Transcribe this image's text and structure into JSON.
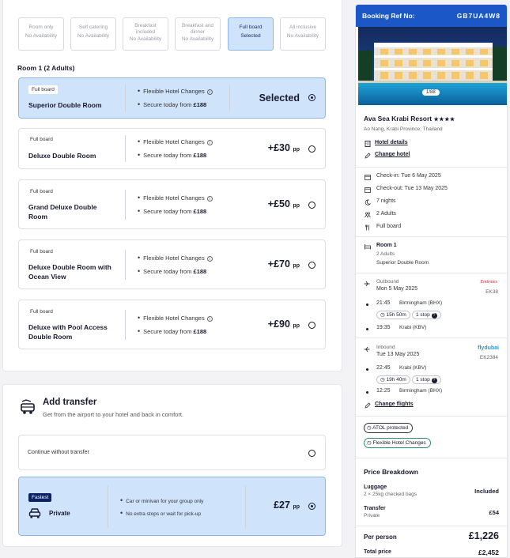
{
  "board_options": [
    {
      "label": "Room only",
      "status": "No Availability"
    },
    {
      "label": "Self catering",
      "status": "No Availability"
    },
    {
      "label": "Breakfast included",
      "status": "No Availability"
    },
    {
      "label": "Breakfast and dinner",
      "status": "No Availability"
    },
    {
      "label": "Full board",
      "status": "Selected"
    },
    {
      "label": "All inclusive",
      "status": "No Availability"
    }
  ],
  "room_heading": "Room 1 (2 Adults)",
  "rooms": [
    {
      "tag": "Full board",
      "name": "Superior Double Room",
      "feature1": "Flexible Hotel Changes",
      "feature2_prefix": "Secure today from",
      "feature2_price": "£188",
      "price": "Selected",
      "pp": ""
    },
    {
      "tag": "Full board",
      "name": "Deluxe Double Room",
      "feature1": "Flexible Hotel Changes",
      "feature2_prefix": "Secure today from",
      "feature2_price": "£188",
      "price": "+£30",
      "pp": "pp"
    },
    {
      "tag": "Full board",
      "name": "Grand Deluxe Double Room",
      "feature1": "Flexible Hotel Changes",
      "feature2_prefix": "Secure today from",
      "feature2_price": "£188",
      "price": "+£50",
      "pp": "pp"
    },
    {
      "tag": "Full board",
      "name": "Deluxe Double Room with Ocean View",
      "feature1": "Flexible Hotel Changes",
      "feature2_prefix": "Secure today from",
      "feature2_price": "£188",
      "price": "+£70",
      "pp": "pp"
    },
    {
      "tag": "Full board",
      "name": "Deluxe with Pool Access Double Room",
      "feature1": "Flexible Hotel Changes",
      "feature2_prefix": "Secure today from",
      "feature2_price": "£188",
      "price": "+£90",
      "pp": "pp"
    }
  ],
  "transfer": {
    "title": "Add transfer",
    "subtitle": "Get from the airport to your hotel and back in comfort.",
    "no_transfer_label": "Continue without transfer",
    "private": {
      "badge": "Fastest",
      "label": "Private",
      "feature1": "Car or minivan for your group only",
      "feature2": "No extra stops or wait for pick-up",
      "price": "£27",
      "pp": "pp"
    }
  },
  "booking": {
    "ref_label": "Booking Ref No:",
    "ref_value": "GB7UA4W8",
    "image_counter": "1/88",
    "hotel_name": "Ava Sea Krabi Resort",
    "stars": "★★★★",
    "location": "Ao Nang, Krabi Province, Thailand",
    "hotel_details_link": "Hotel details",
    "change_hotel_link": "Change hotel",
    "check_in": "Check-in: Tue 6 May 2025",
    "check_out": "Check-out: Tue 13 May 2025",
    "nights": "7 nights",
    "adults": "2 Adults",
    "board": "Full board",
    "room_title": "Room 1",
    "room_adults": "2 Adults",
    "room_type": "Superior Double Room",
    "outbound": {
      "label": "Outbound",
      "date": "Mon 5 May 2025",
      "airline": "Emirates",
      "flight": "EK38",
      "dep_time": "21:45",
      "dep_airport": "Birmingham (BHX)",
      "duration": "15h 50m",
      "stops": "1 stop",
      "arr_time": "19:35",
      "arr_airport": "Krabi (KBV)"
    },
    "inbound": {
      "label": "Inbound",
      "date": "Tue 13 May 2025",
      "airline": "flydubai",
      "flight": "EK2384",
      "dep_time": "22:45",
      "dep_airport": "Krabi (KBV)",
      "duration": "19h 40m",
      "stops": "1 stop",
      "arr_time": "12:25",
      "arr_airport": "Birmingham (BHX)"
    },
    "change_flights_link": "Change flights",
    "atol_chip": "ATOL protected",
    "flex_chip": "Flexible Hotel Changes",
    "breakdown_title": "Price Breakdown",
    "luggage_label": "Luggage",
    "luggage_detail": "2 × 25kg checked bags",
    "luggage_value": "Included",
    "transfer_label": "Transfer",
    "transfer_detail": "Private",
    "transfer_value": "£54",
    "per_person_label": "Per person",
    "per_person_value": "£1,226",
    "total_label": "Total price",
    "total_value": "£2,452"
  },
  "colors": {
    "accent": "#1b57c7",
    "selected_bg": "#cfe3fb",
    "badge_navy": "#0b2265",
    "emirates_red": "#d71921",
    "flydubai_blue": "#1ba0d8"
  }
}
